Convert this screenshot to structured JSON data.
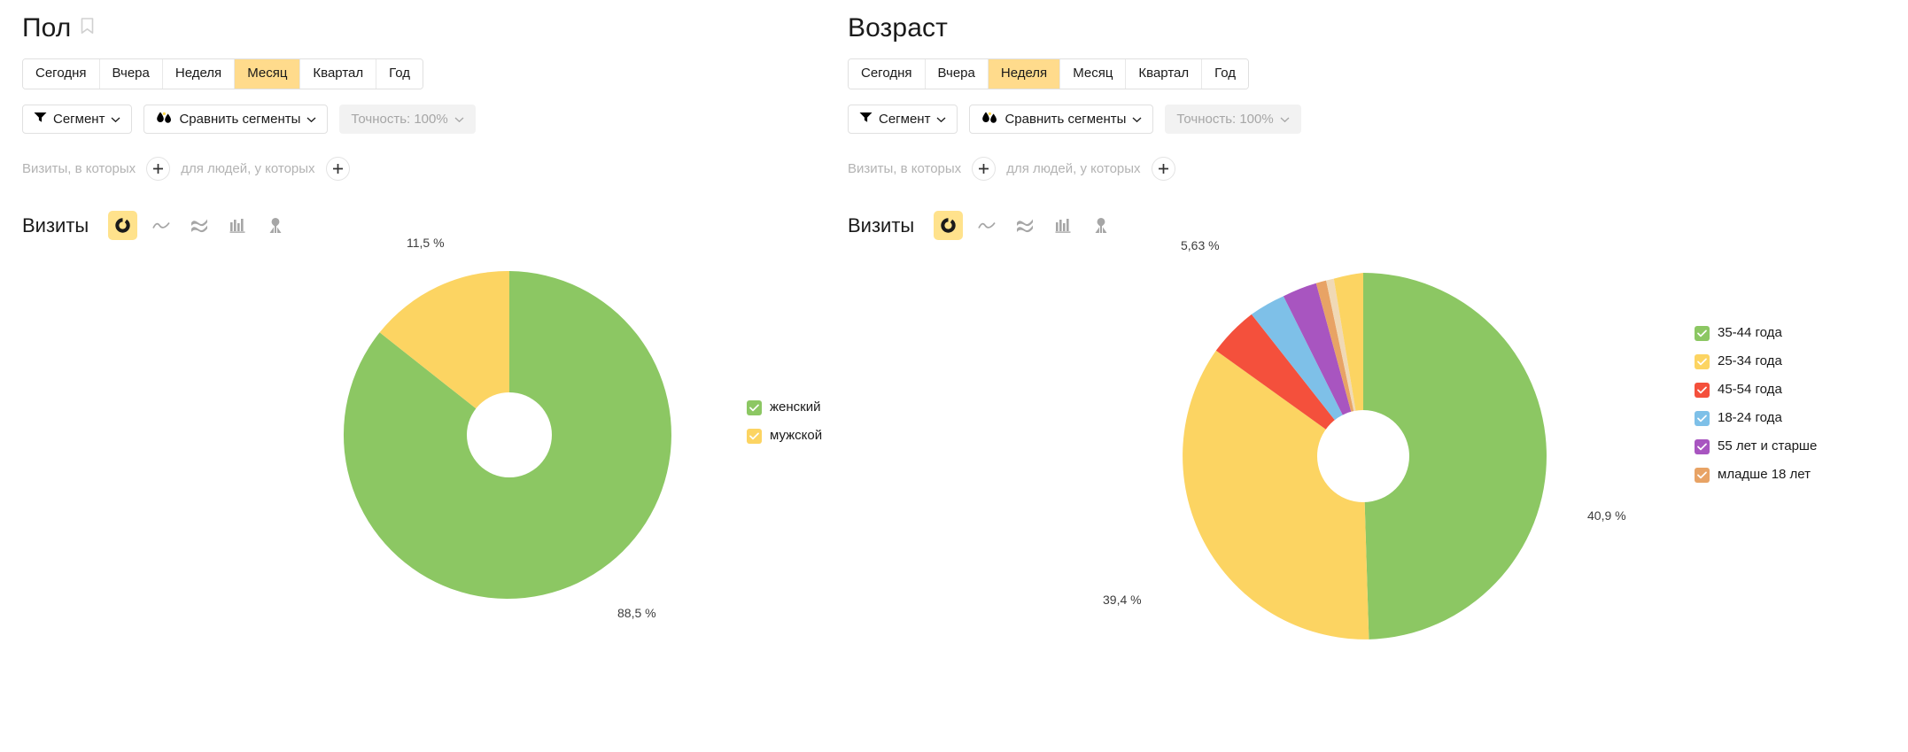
{
  "panels": [
    {
      "id": "gender",
      "title": "Пол",
      "has_bookmark": true,
      "bookmark_icon": "bookmark-icon",
      "periods": [
        {
          "label": "Сегодня",
          "active": false
        },
        {
          "label": "Вчера",
          "active": false
        },
        {
          "label": "Неделя",
          "active": false
        },
        {
          "label": "Месяц",
          "active": true
        },
        {
          "label": "Квартал",
          "active": false
        },
        {
          "label": "Год",
          "active": false
        }
      ],
      "controls": {
        "segment": {
          "label": "Сегмент",
          "icon": "funnel-icon"
        },
        "compare": {
          "label": "Сравнить сегменты",
          "icon": "droplets-icon"
        },
        "accuracy": {
          "label": "Точность: 100%",
          "disabled": true
        }
      },
      "filters": {
        "visits_text": "Визиты, в которых",
        "people_text": "для людей, у которых",
        "add_icon": "plus-icon"
      },
      "metric": {
        "label": "Визиты",
        "viz_buttons": [
          {
            "icon": "pie-chart-icon",
            "active": true
          },
          {
            "icon": "line-chart-icon",
            "active": false
          },
          {
            "icon": "area-chart-icon",
            "active": false
          },
          {
            "icon": "bar-chart-icon",
            "active": false
          },
          {
            "icon": "map-pin-icon",
            "active": false
          }
        ]
      }
    },
    {
      "id": "age",
      "title": "Возраст",
      "has_bookmark": false,
      "bookmark_icon": "bookmark-icon",
      "periods": [
        {
          "label": "Сегодня",
          "active": false
        },
        {
          "label": "Вчера",
          "active": false
        },
        {
          "label": "Неделя",
          "active": true
        },
        {
          "label": "Месяц",
          "active": false
        },
        {
          "label": "Квартал",
          "active": false
        },
        {
          "label": "Год",
          "active": false
        }
      ],
      "controls": {
        "segment": {
          "label": "Сегмент",
          "icon": "funnel-icon"
        },
        "compare": {
          "label": "Сравнить сегменты",
          "icon": "droplets-icon"
        },
        "accuracy": {
          "label": "Точность: 100%",
          "disabled": true
        }
      },
      "filters": {
        "visits_text": "Визиты, в которых",
        "people_text": "для людей, у которых",
        "add_icon": "plus-icon"
      },
      "metric": {
        "label": "Визиты",
        "viz_buttons": [
          {
            "icon": "pie-chart-icon",
            "active": true
          },
          {
            "icon": "line-chart-icon",
            "active": false
          },
          {
            "icon": "area-chart-icon",
            "active": false
          },
          {
            "icon": "bar-chart-icon",
            "active": false
          },
          {
            "icon": "map-pin-icon",
            "active": false
          }
        ]
      }
    }
  ],
  "chart_data": [
    {
      "id": "gender-pie",
      "type": "pie",
      "title": "Пол",
      "metric": "Визиты",
      "donut": true,
      "categories": [
        "женский",
        "мужской"
      ],
      "values": [
        88.5,
        11.5
      ],
      "value_labels": [
        "88,5 %",
        "11,5 %"
      ],
      "colors": [
        "#8cc763",
        "#fcd462"
      ],
      "legend_position": "right",
      "legend": [
        {
          "label": "женский",
          "color": "#8cc763",
          "checked": true
        },
        {
          "label": "мужской",
          "color": "#fcd462",
          "checked": true
        }
      ]
    },
    {
      "id": "age-pie",
      "type": "pie",
      "title": "Возраст",
      "metric": "Визиты",
      "donut": true,
      "categories": [
        "35-44 года",
        "25-34 года",
        "45-54 года",
        "18-24 года",
        "55 лет и старше",
        "младше 18 лет"
      ],
      "values": [
        40.9,
        39.4,
        5.63,
        3.6,
        3.2,
        0.9
      ],
      "value_labels": [
        "40,9 %",
        "39,4 %",
        "5,63 %"
      ],
      "colors": [
        "#8cc763",
        "#fcd462",
        "#f4503c",
        "#7ec0e8",
        "#a855c0",
        "#e8a365"
      ],
      "legend_position": "right",
      "legend": [
        {
          "label": "35-44 года",
          "color": "#8cc763",
          "checked": true
        },
        {
          "label": "25-34 года",
          "color": "#fcd462",
          "checked": true
        },
        {
          "label": "45-54 года",
          "color": "#f4503c",
          "checked": true
        },
        {
          "label": "18-24 года",
          "color": "#7ec0e8",
          "checked": true
        },
        {
          "label": "55 лет и старше",
          "color": "#a855c0",
          "checked": true
        },
        {
          "label": "младше 18 лет",
          "color": "#e8a365",
          "checked": true
        }
      ]
    }
  ]
}
